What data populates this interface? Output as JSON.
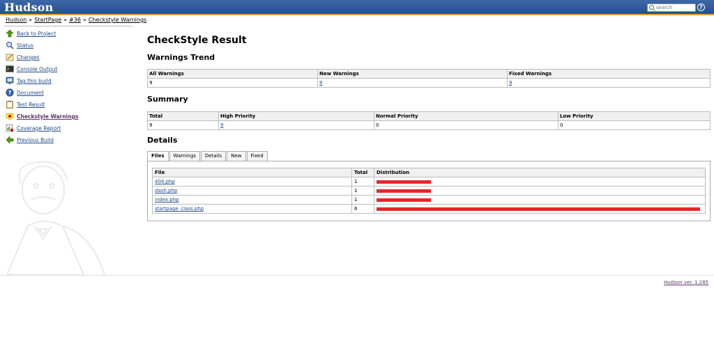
{
  "header": {
    "logo": "Hudson",
    "search": {
      "placeholder": "search"
    },
    "help_icon": "?"
  },
  "breadcrumb": [
    {
      "label": "Hudson"
    },
    {
      "label": "StartPage"
    },
    {
      "label": "#36"
    },
    {
      "label": "Checkstyle Warnings"
    }
  ],
  "breadcrumb_separator": "»",
  "sidebar": {
    "items": [
      {
        "label": "Back to Project",
        "icon": "up-arrow-icon"
      },
      {
        "label": "Status",
        "icon": "magnifier-icon"
      },
      {
        "label": "Changes",
        "icon": "notepad-icon"
      },
      {
        "label": "Console Output",
        "icon": "terminal-icon"
      },
      {
        "label": "Tag this build",
        "icon": "tag-monitor-icon"
      },
      {
        "label": "Document",
        "icon": "help-document-icon"
      },
      {
        "label": "Test Result",
        "icon": "clipboard-icon"
      },
      {
        "label": "Checkstyle Warnings",
        "icon": "checkstyle-icon"
      },
      {
        "label": "Coverage Report",
        "icon": "coverage-report-icon"
      },
      {
        "label": "Previous Build",
        "icon": "left-arrow-icon"
      }
    ]
  },
  "main": {
    "title": "CheckStyle Result",
    "trend": {
      "heading": "Warnings Trend",
      "headers": [
        "All Warnings",
        "New Warnings",
        "Fixed Warnings"
      ],
      "values": [
        "9",
        "9",
        "9"
      ]
    },
    "summary": {
      "heading": "Summary",
      "headers": [
        "Total",
        "High Priority",
        "Normal Priority",
        "Low Priority"
      ],
      "values": [
        "9",
        "9",
        "0",
        "0"
      ]
    },
    "details": {
      "heading": "Details",
      "tabs": [
        "Files",
        "Warnings",
        "Details",
        "New",
        "Fixed"
      ],
      "active_tab": "Files",
      "columns": [
        "File",
        "Total",
        "Distribution"
      ],
      "rows": [
        {
          "file": "404.php",
          "total": "1",
          "distribution": 1
        },
        {
          "file": "dash.php",
          "total": "1",
          "distribution": 1
        },
        {
          "file": "index.php",
          "total": "1",
          "distribution": 1
        },
        {
          "file": "startpage_class.php",
          "total": "6",
          "distribution": 6
        }
      ],
      "bar_color": "#e8262b"
    }
  },
  "footer": {
    "version": "Hudson ver. 1.285"
  }
}
